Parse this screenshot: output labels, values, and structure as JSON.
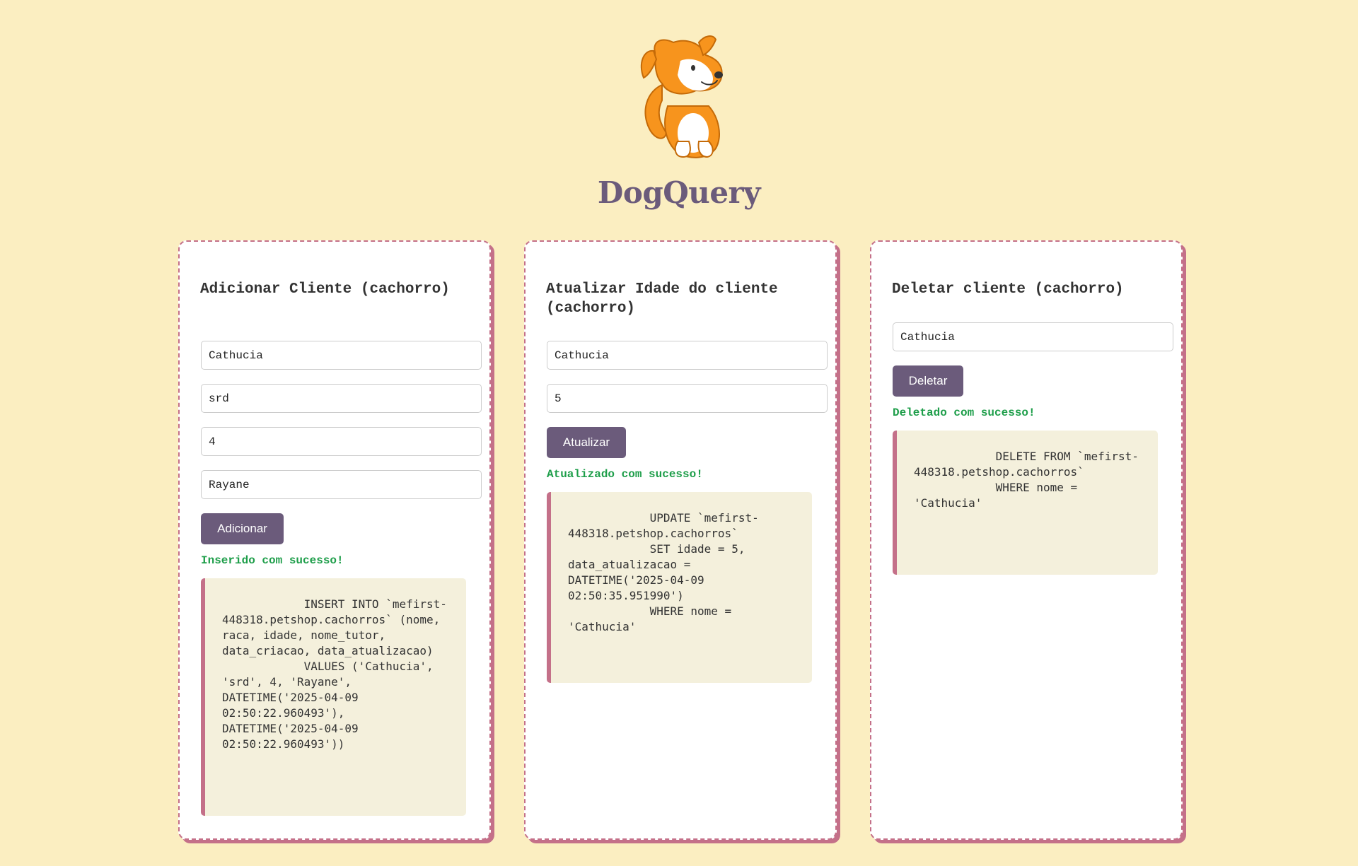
{
  "brand": {
    "title": "DogQuery",
    "logo_icon": "dog-mascot-icon"
  },
  "colors": {
    "background": "#fbeec1",
    "accent": "#6b5b7b",
    "card_border": "#c47089",
    "success": "#1e9e4a",
    "code_bg": "#f4f0dc",
    "logo_orange": "#f7941d"
  },
  "add_card": {
    "title": "Adicionar Cliente (cachorro)",
    "fields": {
      "nome": "Cathucia",
      "raca": "srd",
      "idade": "4",
      "tutor": "Rayane"
    },
    "button_label": "Adicionar",
    "status": "Inserido com sucesso!",
    "query": "            INSERT INTO `mefirst-448318.petshop.cachorros` (nome, raca, idade, nome_tutor, data_criacao, data_atualizacao)\n            VALUES ('Cathucia', 'srd', 4, 'Rayane', DATETIME('2025-04-09 02:50:22.960493'), DATETIME('2025-04-09 02:50:22.960493'))"
  },
  "update_card": {
    "title": "Atualizar Idade do cliente (cachorro)",
    "fields": {
      "nome": "Cathucia",
      "idade": "5"
    },
    "button_label": "Atualizar",
    "status": "Atualizado com sucesso!",
    "query": "            UPDATE `mefirst-448318.petshop.cachorros`\n            SET idade = 5, data_atualizacao = DATETIME('2025-04-09 02:50:35.951990')\n            WHERE nome = 'Cathucia'"
  },
  "delete_card": {
    "title": "Deletar cliente (cachorro)",
    "fields": {
      "nome": "Cathucia"
    },
    "button_label": "Deletar",
    "status": "Deletado com sucesso!",
    "query": "            DELETE FROM `mefirst-448318.petshop.cachorros`\n            WHERE nome = 'Cathucia'"
  }
}
